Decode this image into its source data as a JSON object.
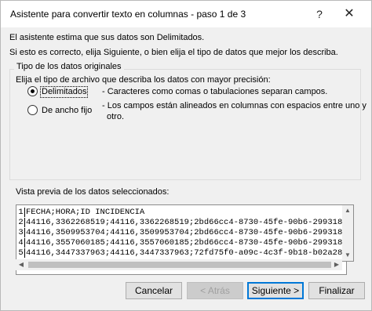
{
  "window": {
    "title": "Asistente para convertir texto en columnas - paso 1 de 3",
    "help_glyph": "?",
    "close_glyph": "✕"
  },
  "intro": {
    "line1": "El asistente estima que sus datos son Delimitados.",
    "line2": "Si esto es correcto, elija Siguiente, o bien elija el tipo de datos que mejor los describa."
  },
  "group": {
    "title": "Tipo de los datos originales",
    "prompt": "Elija el tipo de archivo que describa los datos con mayor precisión:",
    "options": [
      {
        "label": "Delimitados",
        "selected": true,
        "description": "- Caracteres como comas o tabulaciones separan campos."
      },
      {
        "label": "De ancho fijo",
        "selected": false,
        "description": "- Los campos están alineados en columnas con espacios entre uno y",
        "description2": "otro."
      }
    ]
  },
  "preview": {
    "label": "Vista previa de los datos seleccionados:",
    "rows": [
      {
        "num": "1",
        "text": "FECHA;HORA;ID INCIDENCIA"
      },
      {
        "num": "2",
        "text": "44116,3362268519;44116,3362268519;2bd66cc4-8730-45fe-90b6-299318"
      },
      {
        "num": "3",
        "text": "44116,3509953704;44116,3509953704;2bd66cc4-8730-45fe-90b6-299318"
      },
      {
        "num": "4",
        "text": "44116,3557060185;44116,3557060185;2bd66cc4-8730-45fe-90b6-299318"
      },
      {
        "num": "5",
        "text": "44116,3447337963;44116,3447337963;72fd75f0-a09c-4c3f-9b18-b02a28"
      }
    ]
  },
  "buttons": {
    "cancel": "Cancelar",
    "back": "< Atrás",
    "next": "Siguiente >",
    "finish": "Finalizar"
  },
  "colors": {
    "dialog_bg": "#f0f0f0",
    "default_button_border": "#0078d7"
  }
}
